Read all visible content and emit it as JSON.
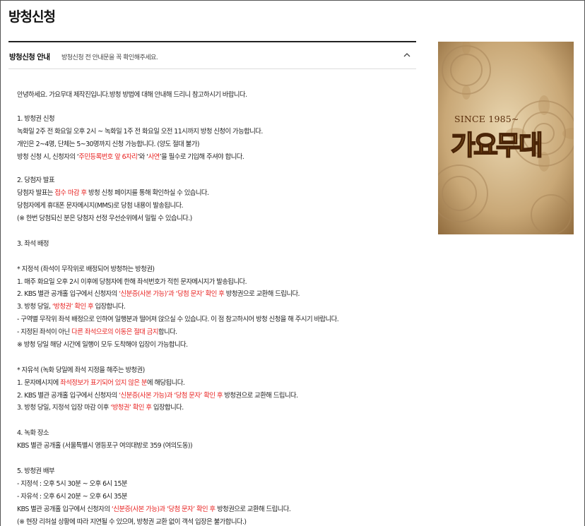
{
  "page": {
    "title": "방청신청"
  },
  "notice": {
    "title": "방청신청 안내",
    "subtitle": "방청신청 전 안내문을 꼭 확인해주세요.",
    "collapse_icon": "chevron-up-icon"
  },
  "poster": {
    "since": "SINCE 1985~",
    "logo": "가요무대"
  },
  "colors": {
    "accent_red": "#e8201f",
    "poster_brown": "#6b3a12"
  },
  "content": {
    "intro": "안녕하세요. 가요무대 제작진입니다.방청 방법에 대해 안내해 드리니 참고하시기 바랍니다.",
    "s1": {
      "heading": "1. 방청권 신청",
      "line1": "녹화일 2주 전 화요일 오후 2시 ~ 녹화일 1주 전 화요일 오전 11시까지 방청 신청이 가능합니다.",
      "line2": "개인은 2~4명, 단체는 5~30명까지 신청 가능합니다. (양도 절대 불가)",
      "line3a": "방청 신청 시, 신청자의 ‘",
      "line3b": "주민등록번호 앞 6자리",
      "line3c": "’와 ‘",
      "line3d": "사연",
      "line3e": "’을 필수로 기입해 주셔야 합니다."
    },
    "s2": {
      "heading": "2. 당첨자 발표",
      "line1a": "당첨자 발표는 ",
      "line1b": "접수 마감 후",
      "line1c": " 방청 신청 페이지를 통해 확인하실 수 있습니다.",
      "line2": "당첨자에게 휴대폰 문자메시지(MMS)로 당첨 내용이 발송됩니다.",
      "line3": "(※ 한번 당첨되신 분은 당첨자 선정 우선순위에서 밀릴 수 있습니다.)"
    },
    "s3": {
      "heading": "3. 좌석 배정",
      "fixed_heading": "* 지정석 (좌석이 무작위로 배정되어 방청하는 방청권)",
      "f1": "1. 매주 화요일 오후 2시 이후에 당첨자에 한해 좌석번호가 적힌 문자메시지가 발송됩니다.",
      "f2a": "2. KBS 별관 공개홀 입구에서 신청자의 ",
      "f2b": "‘신분증(사본 가능)’과 ‘당첨 문자’ 확인 후",
      "f2c": " 방청권으로 교환해 드립니다.",
      "f3a": "3. 방청 당일, ",
      "f3b": "‘방청권’ 확인 후",
      "f3c": " 입장합니다.",
      "f4": "- 구역별 무작위 좌석 배정으로 인하여 일행분과 떨어져 앉으실 수 있습니다. 이 점 참고하시어 방청 신청을 해 주시기 바랍니다.",
      "f5a": "- 지정된 좌석이 아닌 ",
      "f5b": "다른 좌석으로의 이동은 절대 금지",
      "f5c": "합니다.",
      "f6": "※ 방청 당일 해당 시간에 일행이 모두 도착해야 입장이 가능합니다.",
      "free_heading": "* 자유석 (녹화 당일에 좌석 지정을 해주는 방청권)",
      "r1a": "1. 문자메시지에 ",
      "r1b": "좌석정보가 표기되어 있지 않은 분",
      "r1c": "에 해당됩니다.",
      "r2a": "2. KBS 별관 공개홀 입구에서 신청자의 ",
      "r2b": "‘신분증(사본 가능)과 ‘당첨 문자’ 확인 후",
      "r2c": " 방청권으로 교환해 드립니다.",
      "r3a": "3. 방청 당일, 지정석 입장 마감 이후 ",
      "r3b": "‘방청권’ 확인 후",
      "r3c": " 입장합니다."
    },
    "s4": {
      "heading": "4. 녹화 장소",
      "line1": "KBS 별관 공개홀 (서울특별시 영등포구 여의대방로 359 (여의도동))"
    },
    "s5": {
      "heading": "5. 방청권 배부",
      "line1": "- 지정석 : 오후 5시 30분 ~ 오후 6시 15분",
      "line2": "- 자유석 : 오후 6시 20분 ~ 오후 6시 35분",
      "line3a": "KBS 별관 공개홀 입구에서 신청자의 ",
      "line3b": "‘신분증(사본 가능)과 ‘당첨 문자’ 확인 후",
      "line3c": " 방청권으로 교환해 드립니다.",
      "line4": "(※ 현장 리허설 상황에 따라 지연될 수 있으며, 방청권 교환 없이 객석 입장은 불가합니다.)"
    }
  }
}
